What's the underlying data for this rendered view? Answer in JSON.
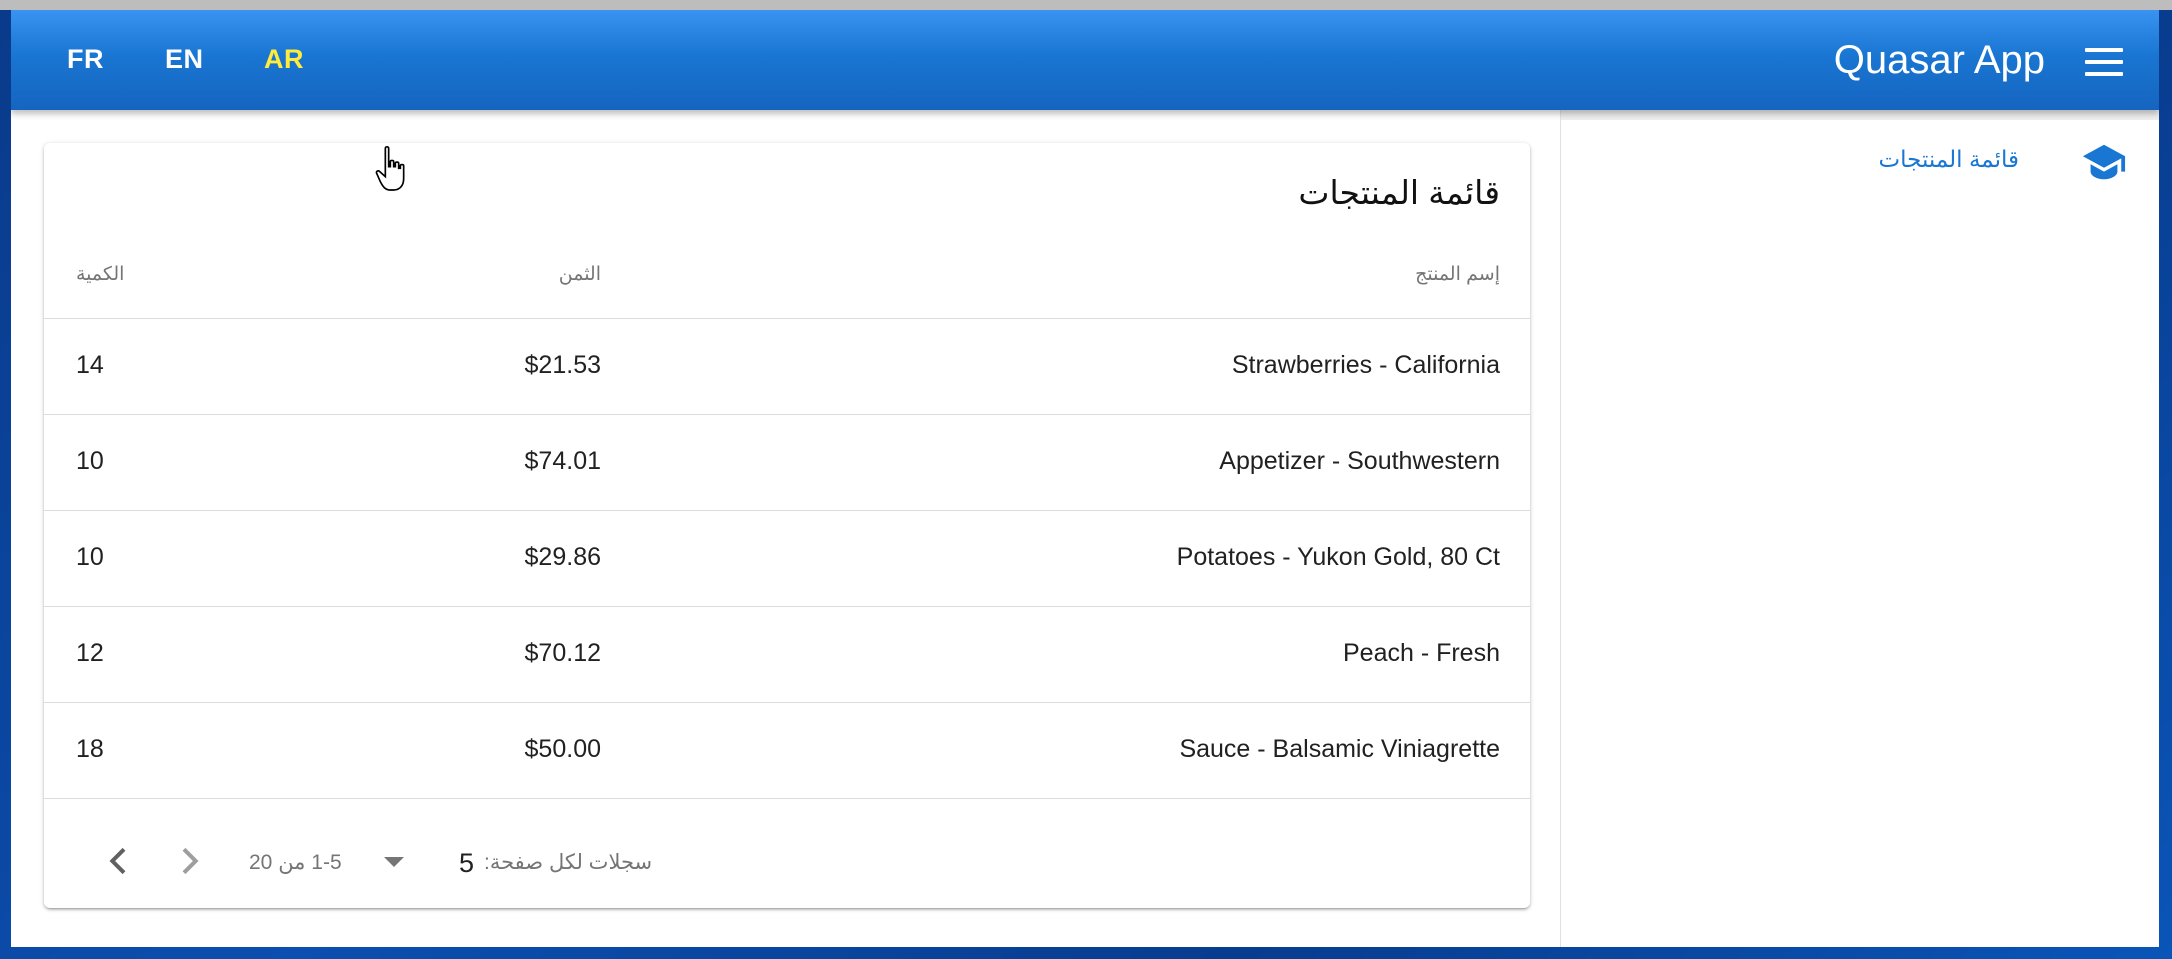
{
  "header": {
    "languages": [
      {
        "code": "FR",
        "active": false
      },
      {
        "code": "EN",
        "active": false
      },
      {
        "code": "AR",
        "active": true
      }
    ],
    "title": "Quasar App",
    "menu_icon": "menu-icon"
  },
  "drawer": {
    "items": [
      {
        "label": "قائمة المنتجات",
        "icon": "graduation-cap-icon"
      }
    ]
  },
  "table": {
    "title": "قائمة المنتجات",
    "columns": {
      "name": "إسم المنتج",
      "price": "الثمن",
      "quantity": "الكمية"
    },
    "rows": [
      {
        "name": "Strawberries - California",
        "price": "$21.53",
        "quantity": "14"
      },
      {
        "name": "Appetizer - Southwestern",
        "price": "$74.01",
        "quantity": "10"
      },
      {
        "name": "Potatoes - Yukon Gold, 80 Ct",
        "price": "$29.86",
        "quantity": "10"
      },
      {
        "name": "Peach - Fresh",
        "price": "$70.12",
        "quantity": "12"
      },
      {
        "name": "Sauce - Balsamic Viniagrette",
        "price": "$50.00",
        "quantity": "18"
      }
    ],
    "pagination": {
      "rows_per_page_label": "سجلات لكل صفحة:",
      "rows_per_page": "5",
      "range": "1-5 من 20"
    }
  },
  "colors": {
    "primary": "#1976d2",
    "active_language": "#ffeb3b"
  }
}
